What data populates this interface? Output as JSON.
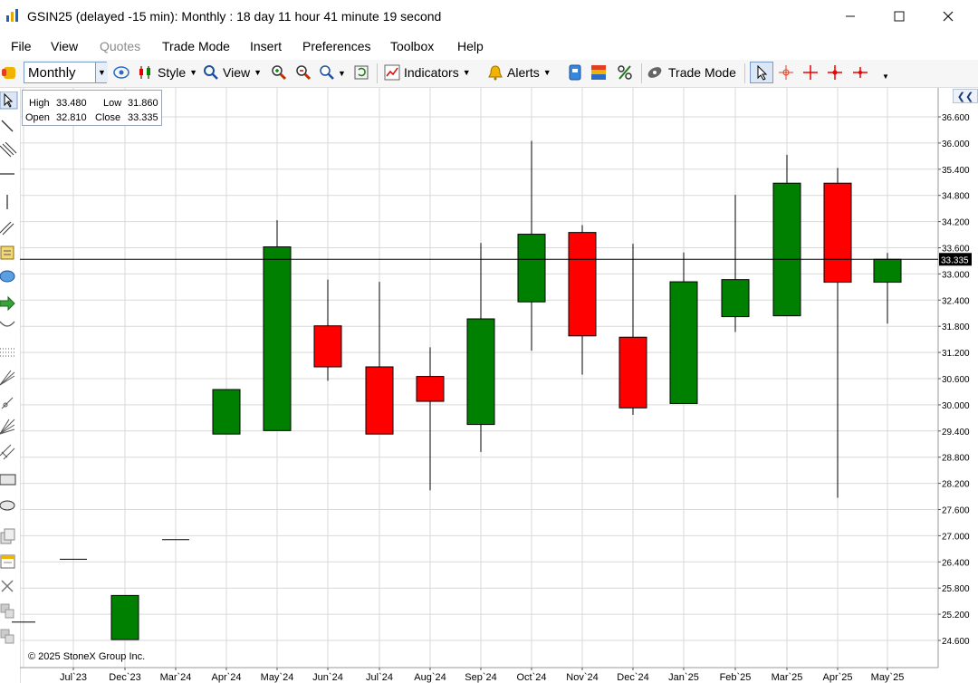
{
  "window": {
    "title": "GSIN25 (delayed -15 min): Monthly : 18 day 11 hour 41 minute 19 second",
    "minimize_icon": "minimize-icon",
    "maximize_icon": "maximize-icon",
    "close_icon": "close-icon"
  },
  "menu": [
    "File",
    "View",
    "Quotes",
    "Trade Mode",
    "Insert",
    "Preferences",
    "Toolbox",
    "Help"
  ],
  "toolbar": {
    "period_value": "Monthly",
    "style_label": "Style",
    "view_label": "View",
    "indicators_label": "Indicators",
    "alerts_label": "Alerts",
    "trade_mode_label": "Trade Mode"
  },
  "ohlc": {
    "high_label": "High",
    "high": "33.480",
    "low_label": "Low",
    "low": "31.860",
    "open_label": "Open",
    "open": "32.810",
    "close_label": "Close",
    "close": "33.335"
  },
  "copyright": "© 2025 StoneX Group Inc.",
  "colors": {
    "up": "#008000",
    "down": "#ff0000",
    "grid": "#d9d9d9",
    "last_price_bg": "#000000"
  },
  "chart_data": {
    "type": "candlestick",
    "x_ticks": [
      "Jul`23",
      "Dec`23",
      "Mar`24",
      "Apr`24",
      "May`24",
      "Jun`24",
      "Jul`24",
      "Aug`24",
      "Sep`24",
      "Oct`24",
      "Nov`24",
      "Dec`24",
      "Jan`25",
      "Feb`25",
      "Mar`25",
      "Apr`25",
      "May`25"
    ],
    "y_ticks": [
      "36.600",
      "36.000",
      "35.400",
      "34.800",
      "34.200",
      "33.600",
      "33.000",
      "32.400",
      "31.800",
      "31.200",
      "30.600",
      "30.000",
      "29.400",
      "28.800",
      "28.200",
      "27.600",
      "27.000",
      "26.400",
      "25.800",
      "25.200",
      "24.600"
    ],
    "ylim": [
      24.3,
      36.95
    ],
    "last_price": "33.335",
    "candles": [
      {
        "x": "Apr`23",
        "open": 25.02,
        "high": 25.02,
        "low": 25.02,
        "close": 25.02
      },
      {
        "x": "Jul`23",
        "open": 26.46,
        "high": 26.46,
        "low": 26.46,
        "close": 26.46
      },
      {
        "x": "Dec`23",
        "open": 24.62,
        "high": 25.63,
        "low": 24.62,
        "close": 25.63
      },
      {
        "x": "Mar`24",
        "open": 26.91,
        "high": 26.91,
        "low": 26.91,
        "close": 26.91
      },
      {
        "x": "Apr`24",
        "open": 29.33,
        "high": 30.35,
        "low": 29.33,
        "close": 30.35
      },
      {
        "x": "May`24",
        "open": 29.41,
        "high": 34.23,
        "low": 29.41,
        "close": 33.62
      },
      {
        "x": "Jun`24",
        "open": 31.81,
        "high": 32.87,
        "low": 30.55,
        "close": 30.87
      },
      {
        "x": "Jul`24",
        "open": 30.87,
        "high": 32.82,
        "low": 29.33,
        "close": 29.33
      },
      {
        "x": "Aug`24",
        "open": 30.65,
        "high": 31.32,
        "low": 28.04,
        "close": 30.08
      },
      {
        "x": "Sep`24",
        "open": 29.55,
        "high": 33.71,
        "low": 28.92,
        "close": 31.97
      },
      {
        "x": "Oct`24",
        "open": 32.36,
        "high": 36.05,
        "low": 31.24,
        "close": 33.91
      },
      {
        "x": "Nov`24",
        "open": 33.95,
        "high": 34.12,
        "low": 30.69,
        "close": 31.58
      },
      {
        "x": "Dec`24",
        "open": 31.55,
        "high": 33.69,
        "low": 29.77,
        "close": 29.93
      },
      {
        "x": "Jan`25",
        "open": 30.03,
        "high": 33.49,
        "low": 30.03,
        "close": 32.82
      },
      {
        "x": "Feb`25",
        "open": 32.02,
        "high": 34.81,
        "low": 31.67,
        "close": 32.87
      },
      {
        "x": "Mar`25",
        "open": 32.04,
        "high": 35.73,
        "low": 32.04,
        "close": 35.08
      },
      {
        "x": "Apr`25",
        "open": 35.08,
        "high": 35.43,
        "low": 27.87,
        "close": 32.81
      },
      {
        "x": "May`25",
        "open": 32.81,
        "high": 33.48,
        "low": 31.86,
        "close": 33.335
      }
    ]
  }
}
